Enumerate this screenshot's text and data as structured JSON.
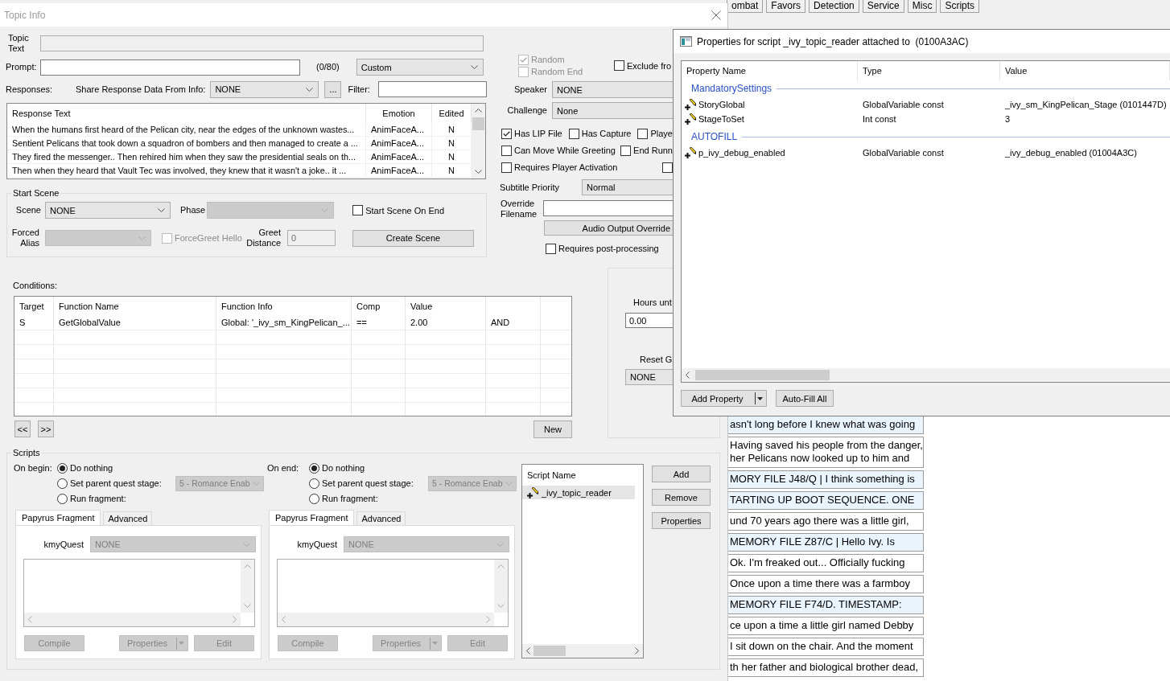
{
  "background_app": {
    "tabs": [
      {
        "label": "ombat"
      },
      {
        "label": "Favors"
      },
      {
        "label": "Detection"
      },
      {
        "label": "Service"
      },
      {
        "label": "Misc"
      },
      {
        "label": "Scripts"
      }
    ],
    "entries": [
      {
        "text": "asn't long before I knew what was going",
        "highlighted": true
      },
      {
        "text": "Having saved his people from the danger,\nher Pelicans now looked up to him and",
        "highlighted": false
      },
      {
        "text": "MORY FILE J48/Q | I think something is",
        "highlighted": true
      },
      {
        "text": "TARTING UP BOOT SEQUENCE. ONE",
        "highlighted": true
      },
      {
        "text": "und 70 years ago there was a little girl,",
        "highlighted": false
      },
      {
        "text": "MEMORY FILE Z87/C | Hello Ivy. Is",
        "highlighted": true
      },
      {
        "text": "Ok. I'm freaked out... Officially fucking",
        "highlighted": false
      },
      {
        "text": "Once upon a time there was a farmboy",
        "highlighted": false
      },
      {
        "text": "MEMORY FILE F74/D. TIMESTAMP:",
        "highlighted": true
      },
      {
        "text": "ce upon a time a little girl named Debby",
        "highlighted": false
      },
      {
        "text": "I sit down on the chair. And the moment",
        "highlighted": false
      },
      {
        "text": "th her father and biological brother dead,",
        "highlighted": false
      }
    ]
  },
  "topic_info": {
    "title": "Topic Info",
    "topic_text": {
      "label": "Topic Text",
      "disabled": true
    },
    "prompt": {
      "label": "Prompt:",
      "counter": "(0/80)"
    },
    "prompt_type": {
      "value": "Custom"
    },
    "responses_label": "Responses:",
    "share_response": {
      "label": "Share Response Data From Info:",
      "value": "NONE"
    },
    "browse_button": "...",
    "filter": {
      "label": "Filter:"
    },
    "response_table": {
      "columns": [
        "Response Text",
        "Emotion",
        "Edited"
      ],
      "rows": [
        [
          "When the humans first heard of the Pelican city, near the edges of the unknown wastes...",
          "AnimFaceA...",
          "N"
        ],
        [
          "Sentient Pelicans that took down a squadron of bombers and then managed to create a ...",
          "AnimFaceA...",
          "N"
        ],
        [
          "They fired the messenger.. Then rehired him when they saw the presidential seals on th...",
          "AnimFaceA...",
          "N"
        ],
        [
          "Then when they heard that Vault Tec was involved, they knew that it wasn't a joke.. it ...",
          "AnimFaceA...",
          "N"
        ]
      ]
    },
    "random": {
      "label": "Random",
      "checked": true,
      "disabled": true
    },
    "random_end": {
      "label": "Random End",
      "checked": false,
      "disabled": true
    },
    "exclude": {
      "label": "Exclude fro",
      "checked": false
    },
    "speaker": {
      "label": "Speaker",
      "value": "NONE"
    },
    "challenge": {
      "label": "Challenge",
      "value": "None"
    },
    "option_rows": [
      [
        {
          "label": "Has LIP File",
          "checked": true
        },
        {
          "label": "Has Capture",
          "checked": false
        },
        {
          "label": "Playe",
          "checked": false
        }
      ],
      [
        {
          "label": "Can Move While Greeting",
          "checked": false
        },
        {
          "label": "End Runn",
          "checked": false
        }
      ],
      [
        {
          "label": "Requires Player Activation",
          "checked": false
        },
        {
          "checked": false
        }
      ]
    ],
    "subtitle_priority": {
      "label": "Subtitle Priority",
      "value": "Normal"
    },
    "override_filename": {
      "label": "Override Filename"
    },
    "audio_output_override_button": "Audio Output Override",
    "requires_post_processing": {
      "label": "Requires post-processing",
      "checked": false
    },
    "start_scene": {
      "title": "Start Scene",
      "scene": {
        "label": "Scene",
        "value": "NONE"
      },
      "phase": {
        "label": "Phase",
        "disabled": true
      },
      "start_scene_on_end": {
        "label": "Start Scene On End",
        "checked": false
      },
      "forced_alias": {
        "label": "Forced Alias",
        "disabled": true
      },
      "force_greet_hello": {
        "label": "ForceGreet Hello",
        "checked": false,
        "disabled": true
      },
      "greet_distance": {
        "label": "Greet Distance",
        "value": "0",
        "disabled": true
      },
      "create_scene_button": "Create Scene"
    },
    "conditions": {
      "label": "Conditions:",
      "columns": [
        "Target",
        "Function Name",
        "Function Info",
        "Comp",
        "Value"
      ],
      "rows": [
        [
          "S",
          "GetGlobalValue",
          "Global: '_ivy_sm_KingPelican_...",
          "==",
          "2.00",
          "AND"
        ]
      ],
      "previous_button": "<<",
      "next_button": ">>",
      "new_button": "New"
    },
    "hours_panel": {
      "hours_label": "Hours unt",
      "hours_value": "0.00",
      "reset_label": "Reset G",
      "reset_value": "NONE"
    },
    "scripts": {
      "title": "Scripts",
      "fragments": [
        {
          "label": "On begin:",
          "actions": [
            {
              "label": "Do nothing",
              "selected": true
            },
            {
              "label": "Set parent quest stage:",
              "selected": false,
              "stage": {
                "value": "5 - Romance Enab",
                "disabled": true
              }
            },
            {
              "label": "Run fragment:",
              "selected": false
            }
          ],
          "tabs": [
            {
              "label": "Papyrus Fragment",
              "selected": true
            },
            {
              "label": "Advanced",
              "selected": false
            }
          ],
          "kmyquest": {
            "label": "kmyQuest",
            "value": "NONE",
            "disabled": true
          },
          "buttons": [
            {
              "label": "Compile",
              "kind": "plain",
              "disabled": true
            },
            {
              "label": "Properties",
              "kind": "split",
              "disabled": true
            },
            {
              "label": "Edit",
              "kind": "plain",
              "disabled": true
            }
          ]
        },
        {
          "label": "On end:",
          "actions": [
            {
              "label": "Do nothing",
              "selected": true
            },
            {
              "label": "Set parent quest stage:",
              "selected": false,
              "stage": {
                "value": "5 - Romance Enab",
                "disabled": true
              }
            },
            {
              "label": "Run fragment:",
              "selected": false
            }
          ],
          "tabs": [
            {
              "label": "Papyrus Fragment",
              "selected": true
            },
            {
              "label": "Advanced",
              "selected": false
            }
          ],
          "kmyquest": {
            "label": "kmyQuest",
            "value": "NONE",
            "disabled": true
          },
          "buttons": [
            {
              "label": "Compile",
              "kind": "plain",
              "disabled": true
            },
            {
              "label": "Properties",
              "kind": "split",
              "disabled": true
            },
            {
              "label": "Edit",
              "kind": "plain",
              "disabled": true
            }
          ]
        }
      ],
      "script_list": {
        "column": "Script Name",
        "items": [
          {
            "name": "_ivy_topic_reader",
            "selected": true
          }
        ]
      },
      "buttons": [
        "Add",
        "Remove",
        "Properties"
      ]
    }
  },
  "properties_window": {
    "title": "Properties for script _ivy_topic_reader attached to  (0100A3AC)",
    "columns": [
      "Property Name",
      "Type",
      "Value"
    ],
    "groups": [
      {
        "name": "MandatorySettings",
        "properties": [
          {
            "name": "StoryGlobal",
            "type": "GlobalVariable const",
            "value": "_ivy_sm_KingPelican_Stage (0101447D)"
          },
          {
            "name": "StageToSet",
            "type": "Int const",
            "value": "3"
          }
        ]
      },
      {
        "name": "AUTOFILL",
        "properties": [
          {
            "name": "p_ivy_debug_enabled",
            "type": "GlobalVariable const",
            "value": "_ivy_debug_enabled (01004A3C)"
          }
        ]
      }
    ],
    "buttons": [
      {
        "label": "Add Property",
        "kind": "split"
      },
      {
        "label": "Auto-Fill All",
        "kind": "plain"
      }
    ]
  }
}
